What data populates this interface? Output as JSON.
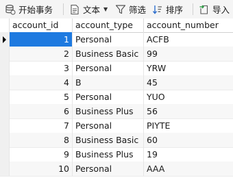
{
  "toolbar": {
    "begin_transaction": "开始事务",
    "text": "文本",
    "filter": "筛选",
    "sort": "排序",
    "import": "导入"
  },
  "grid": {
    "columns": [
      "account_id",
      "account_type",
      "account_number"
    ],
    "selected_row": 0,
    "rows": [
      {
        "id": "1",
        "type": "Personal",
        "number": "ACFB"
      },
      {
        "id": "2",
        "type": "Business Basic",
        "number": "99"
      },
      {
        "id": "3",
        "type": "Personal",
        "number": "YRW"
      },
      {
        "id": "4",
        "type": "B",
        "number": "45"
      },
      {
        "id": "5",
        "type": "Personal",
        "number": "YUO"
      },
      {
        "id": "6",
        "type": "Business Plus",
        "number": "56"
      },
      {
        "id": "7",
        "type": "Personal",
        "number": "PIYTE"
      },
      {
        "id": "8",
        "type": "Business Basic",
        "number": "60"
      },
      {
        "id": "9",
        "type": "Business Plus",
        "number": "19"
      },
      {
        "id": "10",
        "type": "Personal",
        "number": "AAA"
      }
    ]
  },
  "colors": {
    "selection": "#1e7ae0",
    "icon_blue": "#2f6fce"
  },
  "icons": [
    "begin-transaction-icon",
    "text-icon",
    "filter-icon",
    "sort-icon",
    "import-icon"
  ]
}
